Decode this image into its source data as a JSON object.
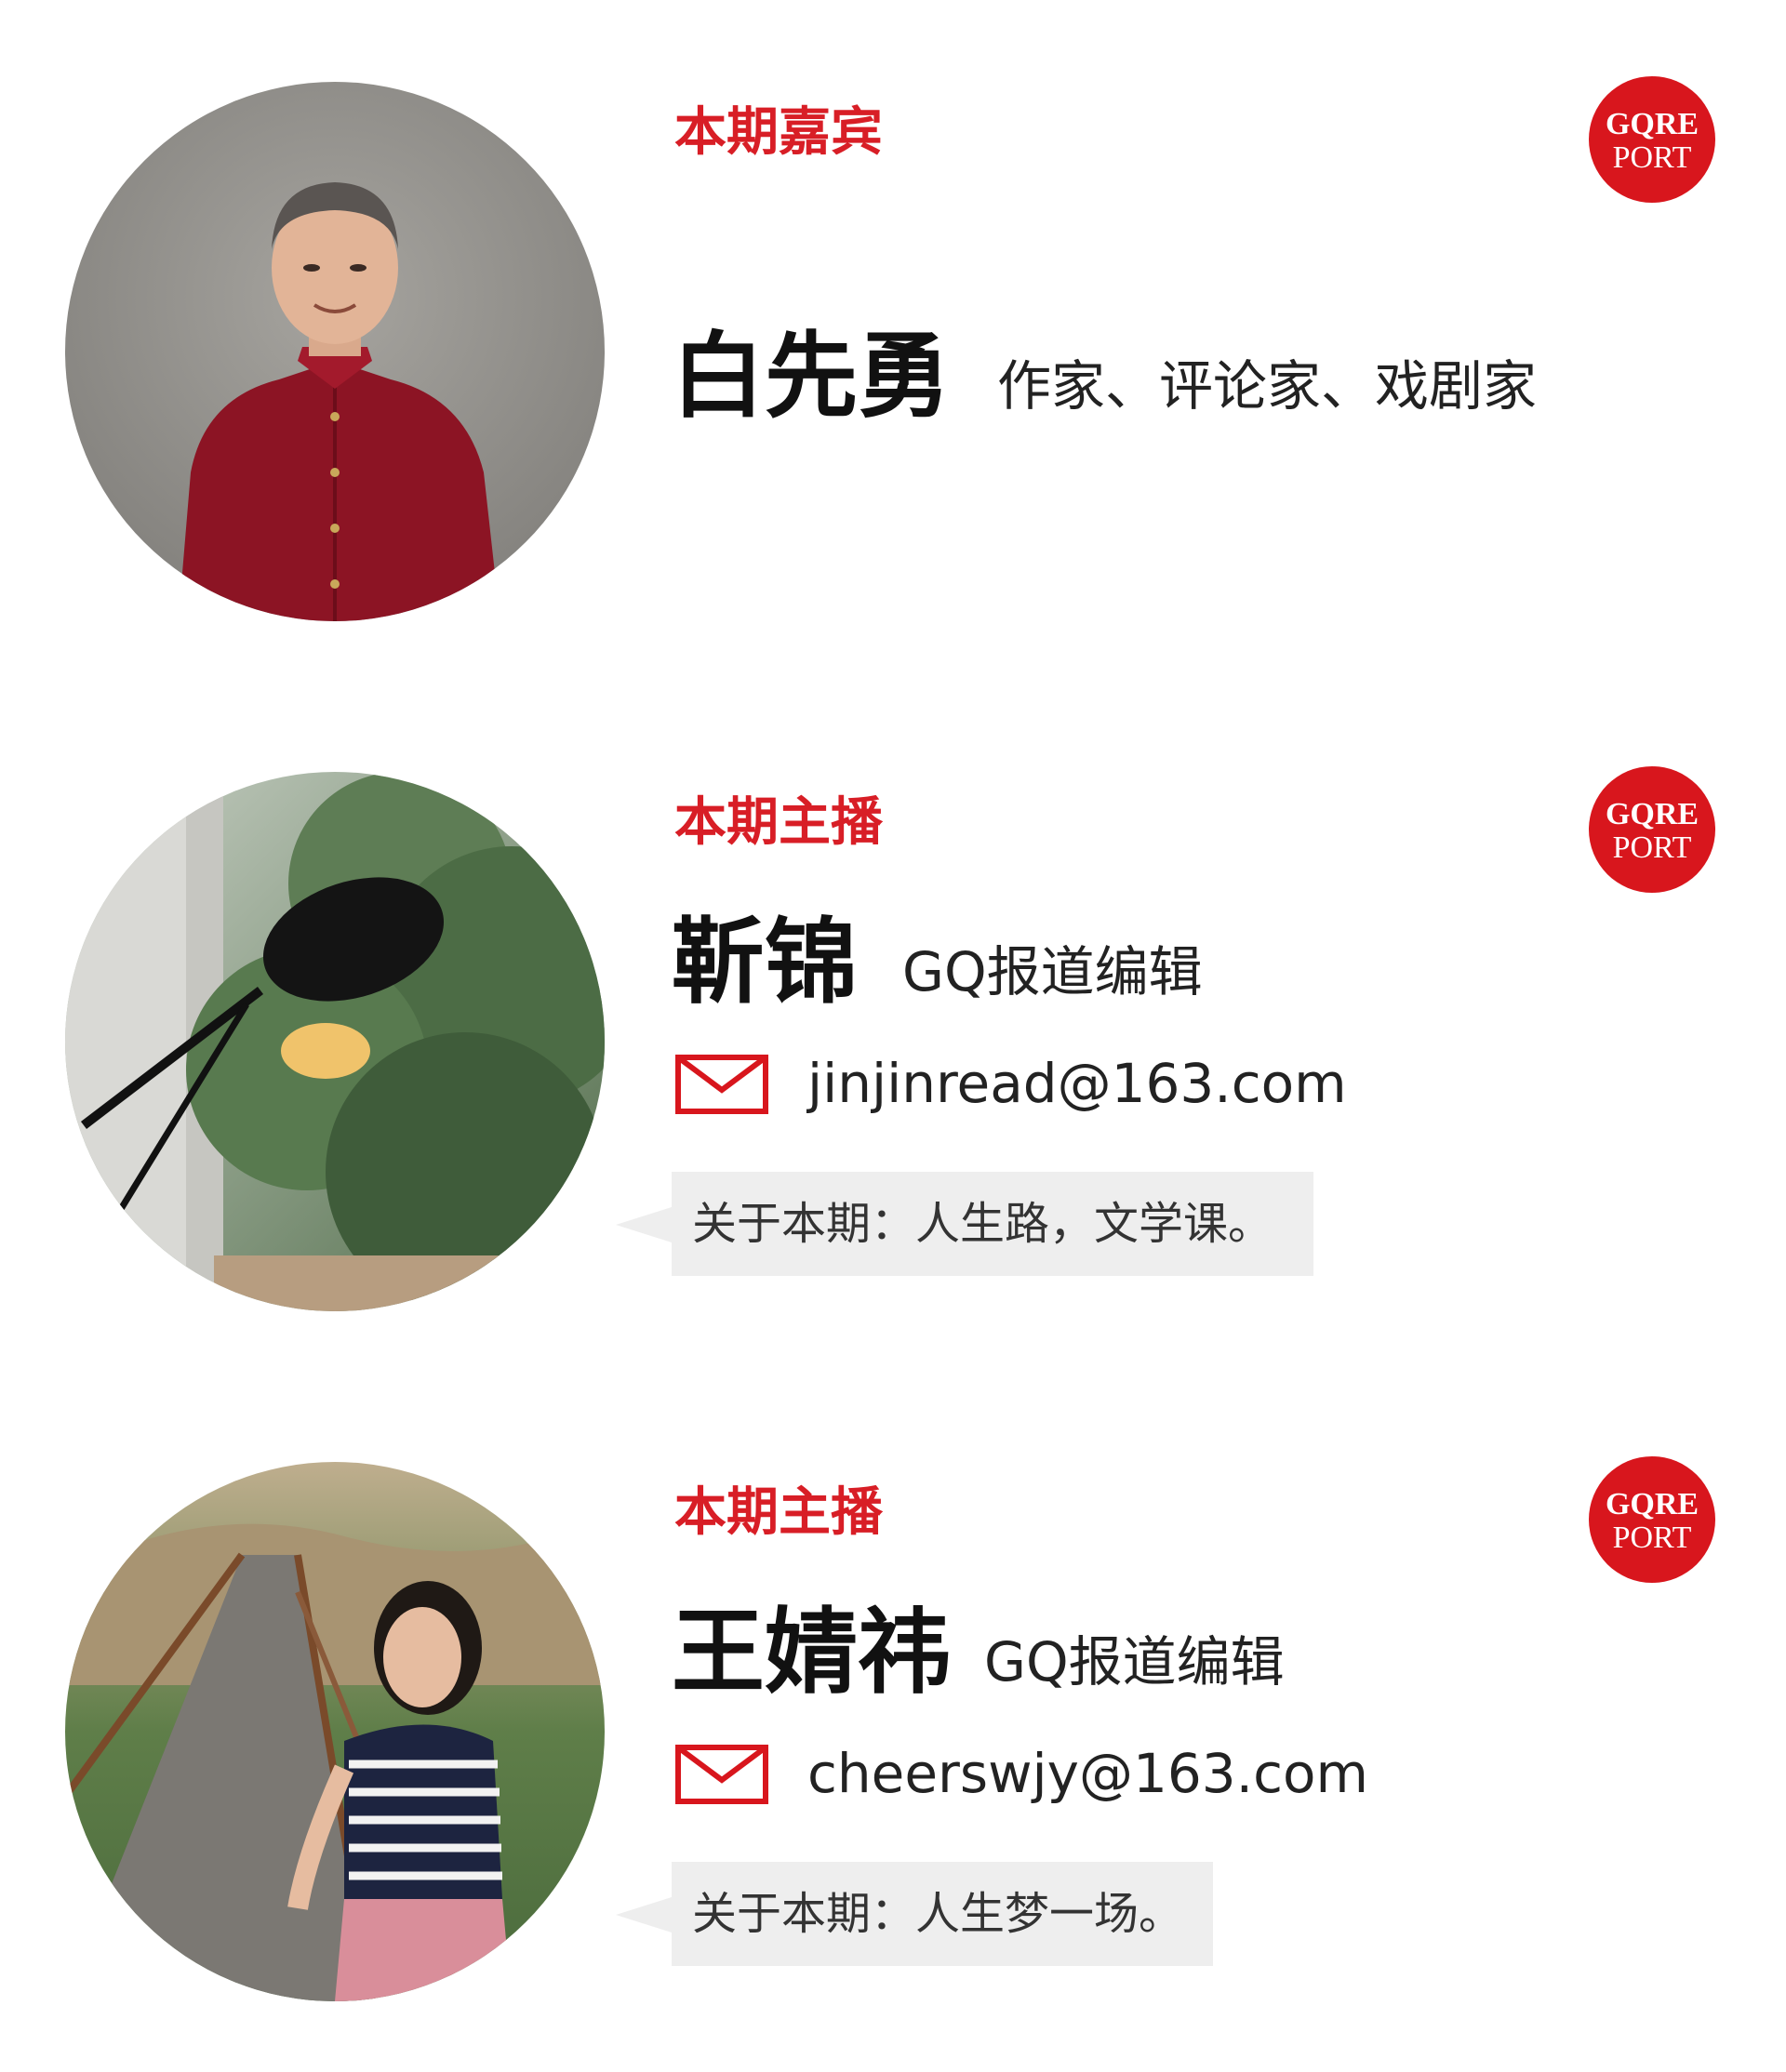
{
  "brand": {
    "logo_line1": "GQRE",
    "logo_line2": "PORT",
    "accent_color": "#d8161d"
  },
  "guest": {
    "role_label": "本期嘉宾",
    "name": "白先勇",
    "title": "作家、评论家、戏剧家",
    "avatar_icon": "portrait-photo"
  },
  "hosts": [
    {
      "role_label": "本期主播",
      "name": "靳锦",
      "title": "GQ报道编辑",
      "email": "jinjinread@163.com",
      "about": "关于本期：人生路，文学课。",
      "mail_icon": "envelope-icon"
    },
    {
      "role_label": "本期主播",
      "name": "王婧祎",
      "title": "GQ报道编辑",
      "email": "cheerswjy@163.com",
      "about": "关于本期：人生梦一场。",
      "mail_icon": "envelope-icon"
    }
  ]
}
